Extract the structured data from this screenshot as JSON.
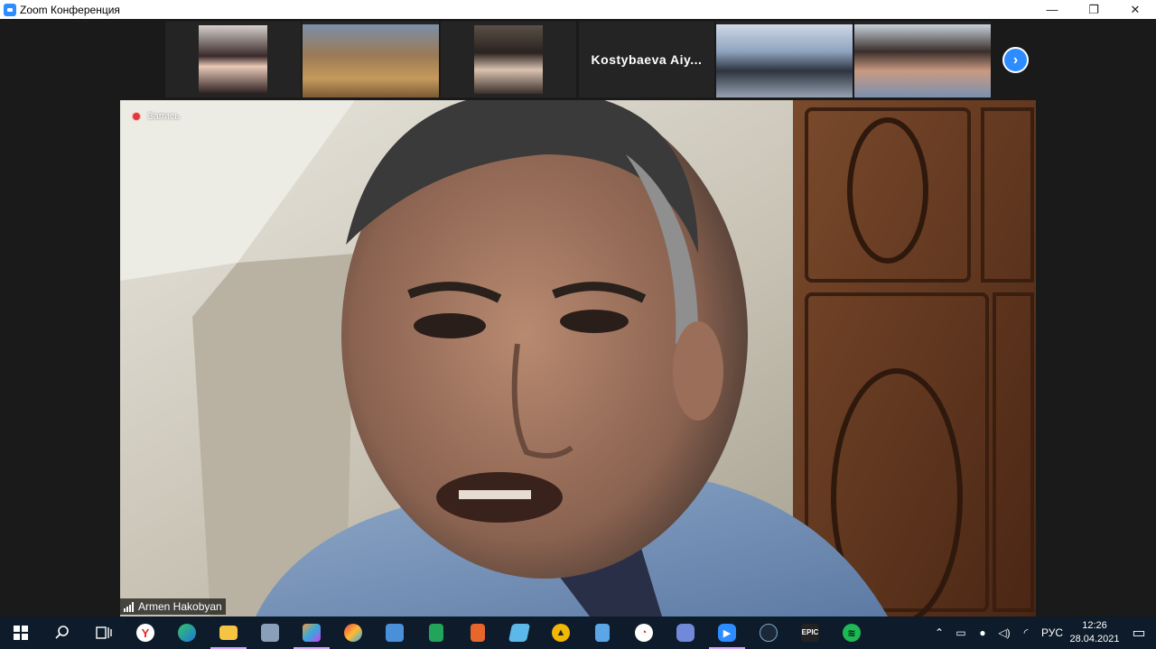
{
  "window": {
    "title": "Zoom Конференция",
    "controls": {
      "minimize": "—",
      "restore": "❐",
      "close": "✕"
    }
  },
  "gallery": {
    "name_tile": "Kostybaeva  Aiy...",
    "next_icon": "chevron-right-icon"
  },
  "main_video": {
    "recording_label": "Запись",
    "speaker_name": "Armen Hakobyan"
  },
  "taskbar": {
    "apps": [
      "start",
      "search",
      "task-view",
      "yandex",
      "edge",
      "file-explorer",
      "photos",
      "paint",
      "paint-3d",
      "app-blue",
      "sheets",
      "docs",
      "app-cube",
      "app-triangle",
      "calculator",
      "app-clock",
      "discord",
      "zoom",
      "steam",
      "epic-games",
      "spotify"
    ],
    "language": "РУС",
    "time": "12:26",
    "date": "28.04.2021"
  },
  "colors": {
    "zoom_blue": "#2d8cff",
    "taskbar_bg": "#0d1b2a",
    "stage_bg": "#1a1a1a"
  }
}
